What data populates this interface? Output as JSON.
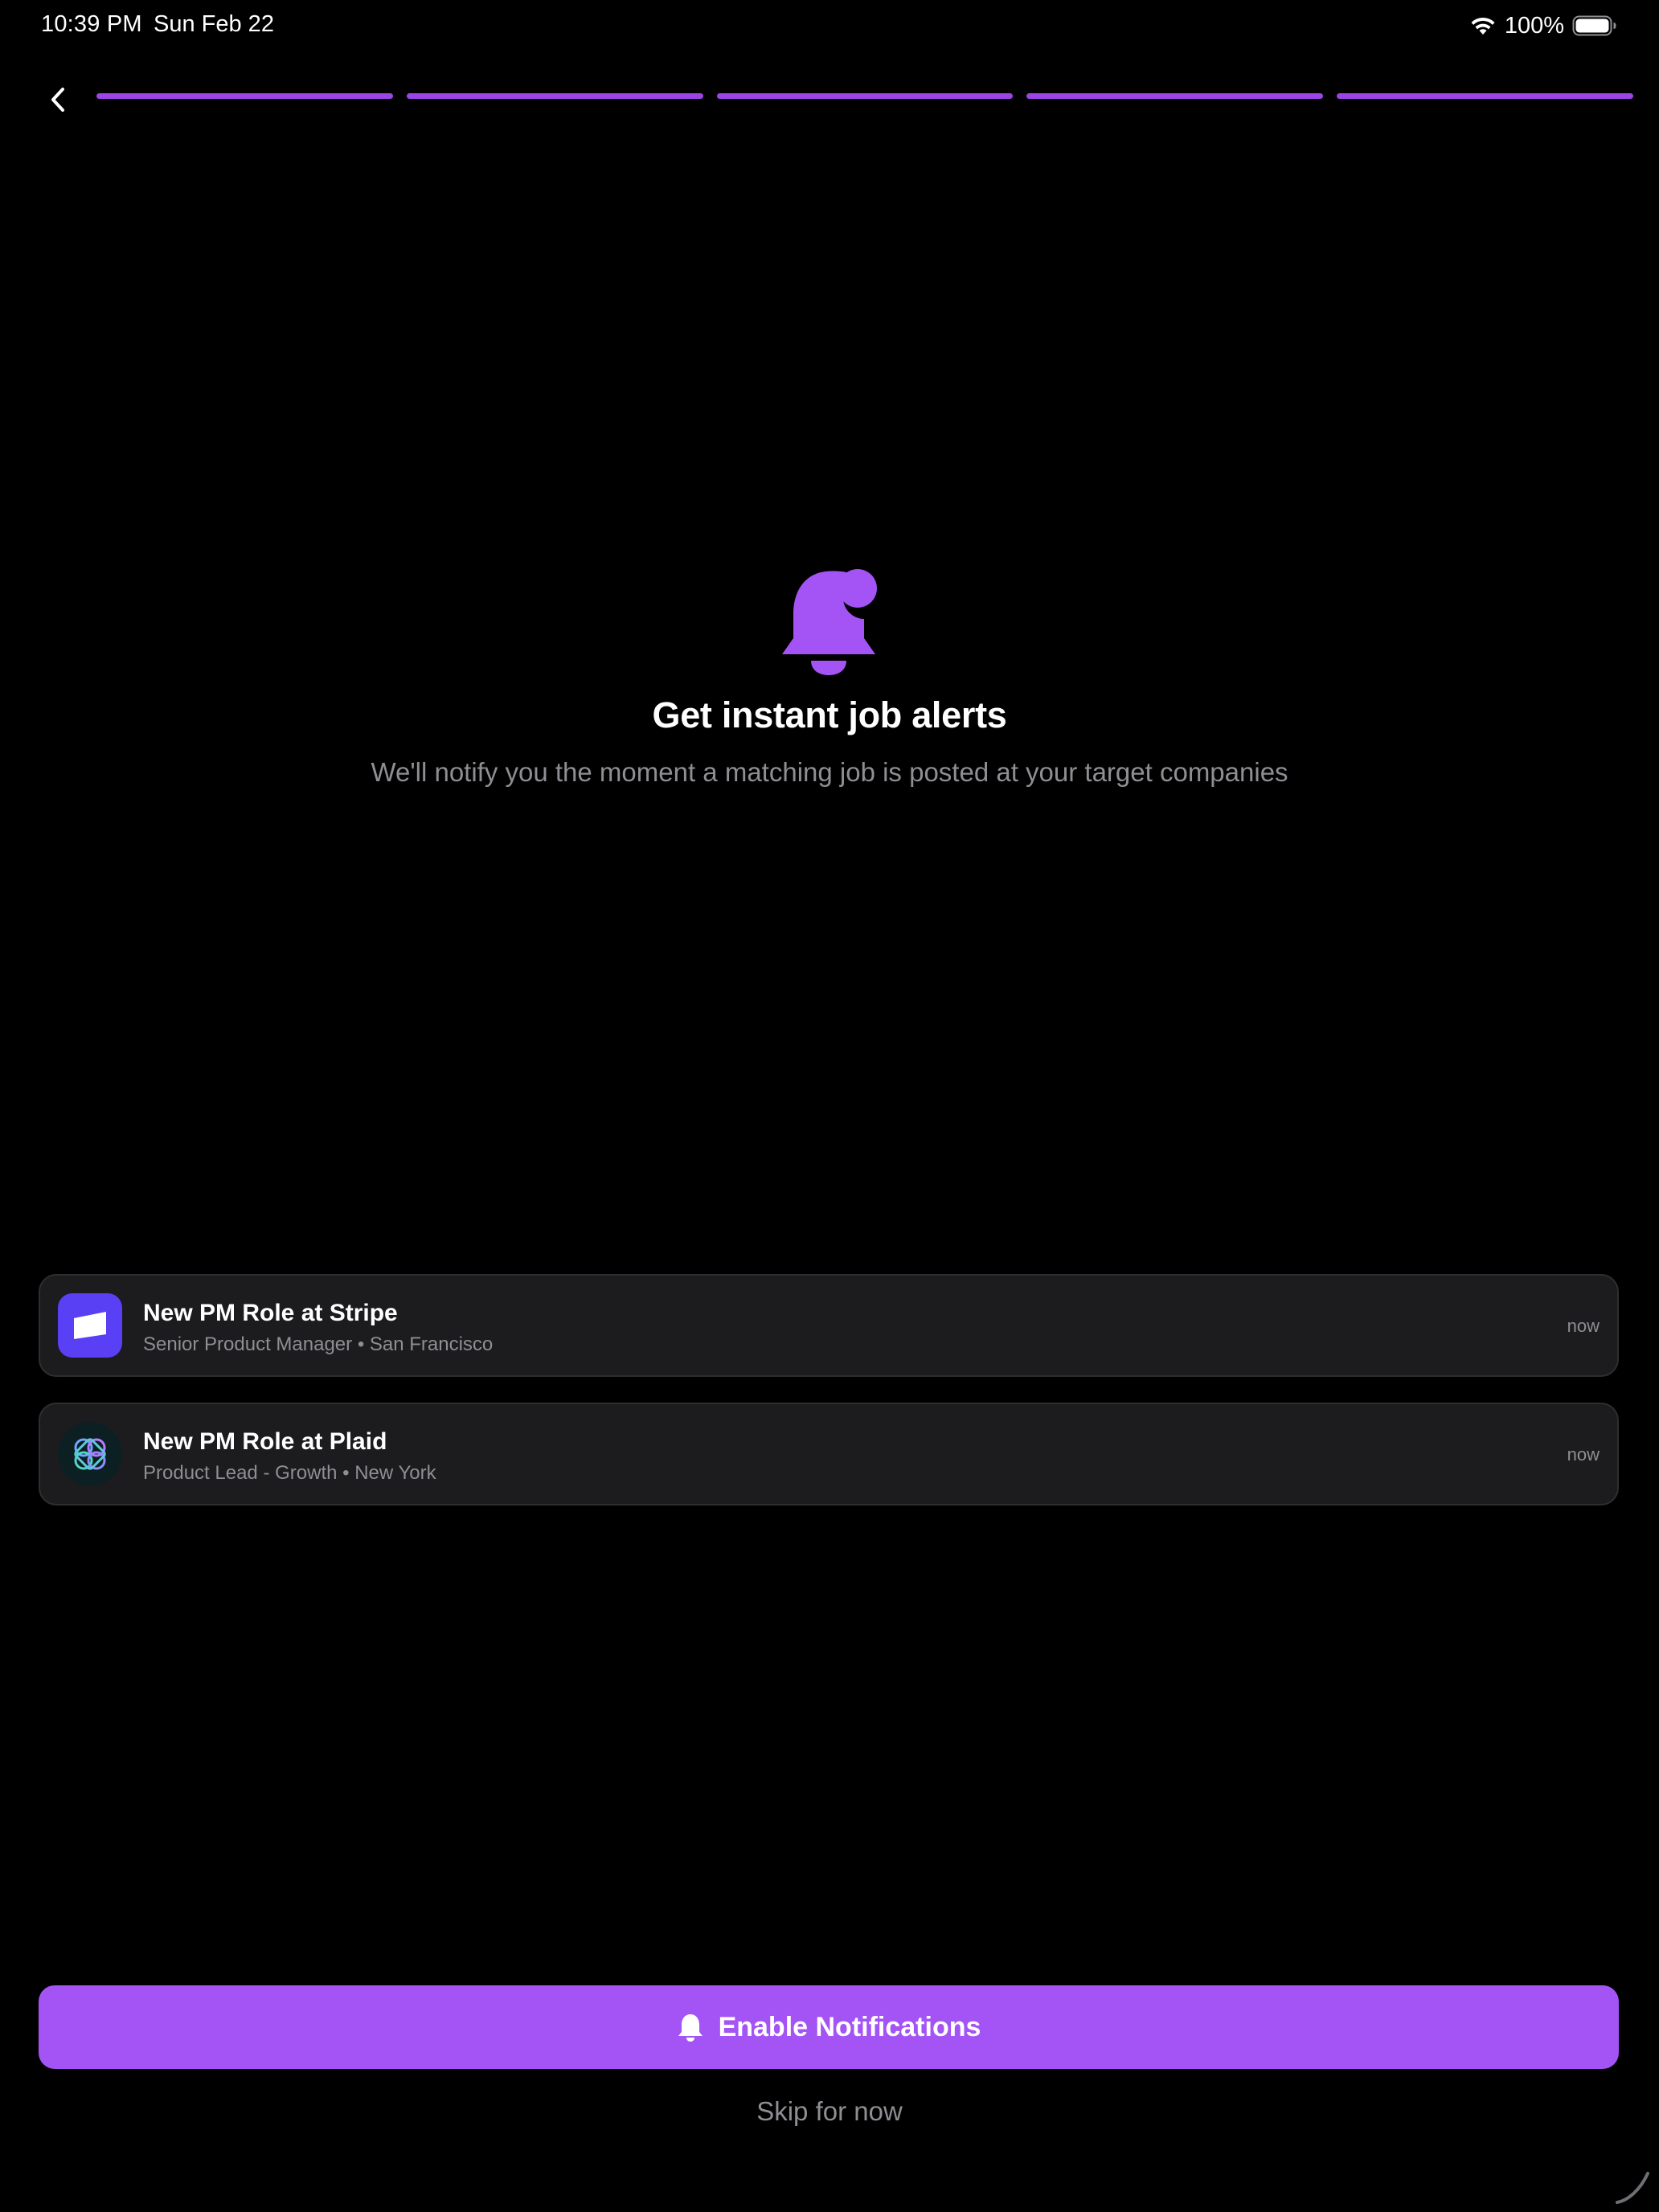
{
  "status_bar": {
    "time": "10:39 PM",
    "date": "Sun Feb 22",
    "battery": "100%",
    "icons": [
      "wifi-icon",
      "battery-icon"
    ]
  },
  "nav": {
    "back_icon": "chevron-left-icon",
    "progress": {
      "total_steps": 5,
      "completed_steps": 5
    }
  },
  "hero": {
    "icon": "bell-badge-icon",
    "title": "Get instant job alerts",
    "subtitle": "We'll notify you the moment a matching job is posted at your target companies"
  },
  "alerts": [
    {
      "logo": "stripe-logo",
      "title": "New PM Role at Stripe",
      "subtitle": "Senior Product Manager • San Francisco",
      "time": "now"
    },
    {
      "logo": "plaid-logo",
      "title": "New PM Role at Plaid",
      "subtitle": "Product Lead - Growth • New York",
      "time": "now"
    }
  ],
  "actions": {
    "enable_label": "Enable Notifications",
    "enable_icon": "bell-icon",
    "skip_label": "Skip for now"
  },
  "colors": {
    "accent": "#a453f4",
    "progress": "#9b45e6",
    "background": "#000000",
    "card": "#1c1c1e",
    "muted_text": "#8e8e93",
    "stripe_brand": "#5a40f5"
  }
}
